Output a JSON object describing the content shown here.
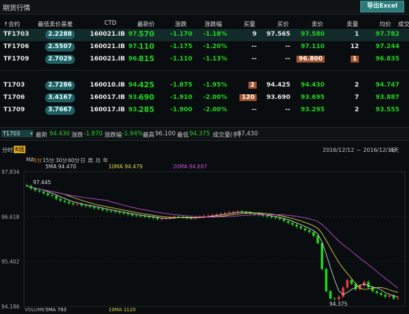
{
  "window": {
    "title": "期货行情",
    "export_label": "导出Excel"
  },
  "table": {
    "headers": [
      "↑合约",
      "最低卖价基差",
      "CTD",
      "最新价",
      "涨跌",
      "涨跌幅",
      "买量",
      "买价",
      "卖价",
      "卖量",
      "均价",
      "成交"
    ],
    "rows": [
      {
        "contract": "TF1703",
        "basis": "2.2288",
        "ctd": "160021.IB",
        "last_a": "97.",
        "last_b": "570",
        "chg": "-1.170",
        "pct": "-1.18%",
        "bidvol": "9",
        "bid": "97.565",
        "ask": "97.580",
        "askvol": "1",
        "avg": "97.782"
      },
      {
        "contract": "TF1706",
        "basis": "2.5507",
        "ctd": "160021.IB",
        "last_a": "97.",
        "last_b": "110",
        "chg": "-1.175",
        "pct": "-1.20%",
        "bidvol": "--",
        "bid": "--",
        "ask": "97.110",
        "askvol": "12",
        "avg": "97.244"
      },
      {
        "contract": "TF1709",
        "basis": "2.7029",
        "ctd": "160021.IB",
        "last_a": "96.",
        "last_b": "815",
        "chg": "-1.110",
        "pct": "-1.13%",
        "bidvol": "--",
        "bid": "--",
        "ask": "96.800",
        "askvol": "1",
        "avg": "96.835"
      },
      {
        "contract": "T1703",
        "basis": "2.7286",
        "ctd": "160010.IB",
        "last_a": "94.",
        "last_b": "425",
        "chg": "-1.875",
        "pct": "-1.95%",
        "bidvol": "2",
        "bid": "94.425",
        "ask": "94.430",
        "askvol": "2",
        "avg": "94.747"
      },
      {
        "contract": "T1706",
        "basis": "3.4167",
        "ctd": "160017.IB",
        "last_a": "93.",
        "last_b": "690",
        "chg": "-1.910",
        "pct": "-2.00%",
        "bidvol": "120",
        "bid": "93.690",
        "ask": "93.695",
        "askvol": "7",
        "avg": "93.887"
      },
      {
        "contract": "T1709",
        "basis": "3.7667",
        "ctd": "160017.IB",
        "last_a": "93.",
        "last_b": "285",
        "chg": "-1.900",
        "pct": "-2.00%",
        "bidvol": "--",
        "bid": "--",
        "ask": "93.295",
        "askvol": "2",
        "avg": "93.555"
      }
    ]
  },
  "info": {
    "symbol": "T1703",
    "last_label": "最新",
    "last": "94.430",
    "chg_label": "涨跌",
    "chg": "-1.870",
    "pct_label": "涨跌幅",
    "pct": "-1.94%",
    "high_label": "最高",
    "high": "96.100",
    "low_label": "最低",
    "low": "94.375",
    "vol_label": "成交量(手)",
    "vol": "87,430"
  },
  "tabs": {
    "time": "分时",
    "kline": "K线",
    "periods": [
      "5分",
      "15分",
      "30分",
      "60分",
      "日",
      "周",
      "月",
      "年"
    ],
    "range": "2016/12/12 － 2016/12/15",
    "days": "4天"
  },
  "ma": {
    "label": "MA",
    "ma5": "5MA 94.470",
    "ma10": "10MA 94.479",
    "ma20": "20MA 94.697"
  },
  "chart_data": {
    "type": "candlestick",
    "yticks": [
      "97.834",
      "96.618",
      "95.402",
      "94.186"
    ],
    "annotations": [
      "97.445",
      "94.375"
    ],
    "volume_label": "VOLUME",
    "vol5": "5MA 783",
    "vol10": "10MA 1120",
    "ylim": [
      94.186,
      97.834
    ],
    "close": [
      97.45,
      97.38,
      97.33,
      97.3,
      97.25,
      97.2,
      97.18,
      97.1,
      97.05,
      97.02,
      96.98,
      96.95,
      96.96,
      96.92,
      96.9,
      96.88,
      96.85,
      96.83,
      96.8,
      96.78,
      96.76,
      96.74,
      96.72,
      96.7,
      96.68,
      96.65,
      96.64,
      96.63,
      96.62,
      96.6,
      96.58,
      96.55,
      96.56,
      96.58,
      96.6,
      96.62,
      96.61,
      96.6,
      96.58,
      96.57,
      96.6,
      96.62,
      96.64,
      96.65,
      96.66,
      96.68,
      96.7,
      96.72,
      96.74,
      96.75,
      96.76,
      96.74,
      96.72,
      96.7,
      96.68,
      96.66,
      96.64,
      96.62,
      96.6,
      96.58,
      96.55,
      96.5,
      96.45,
      96.4,
      96.35,
      96.3,
      96.25,
      96.2,
      96.1,
      95.9,
      95.2,
      94.6,
      94.4,
      94.38,
      94.45,
      94.7,
      94.9,
      94.8,
      94.65,
      94.75,
      94.85,
      94.7,
      94.6,
      94.55,
      94.5,
      94.45,
      94.48,
      94.4,
      94.42
    ]
  }
}
